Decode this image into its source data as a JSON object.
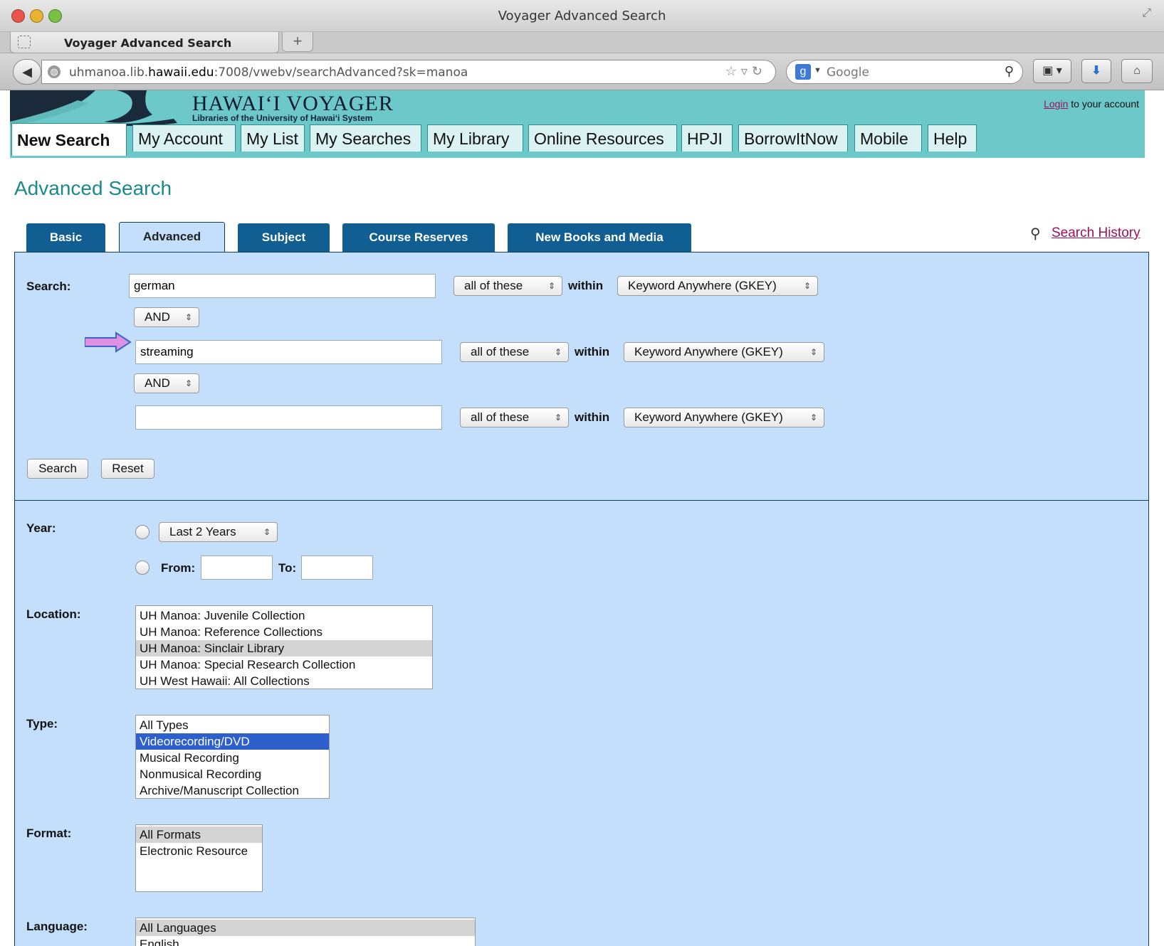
{
  "window": {
    "title": "Voyager Advanced Search"
  },
  "browser": {
    "tab_title": "Voyager Advanced Search",
    "new_tab": "+",
    "url_host_pre": "uhmanoa.lib.",
    "url_host_bold": "hawaii.edu",
    "url_rest": ":7008/vwebv/searchAdvanced?sk=manoa",
    "search_engine": "Google"
  },
  "header": {
    "site_title": "HAWAI‘I VOYAGER",
    "site_subtitle": "Libraries of the University of Hawai‘i System",
    "login_link": "Login",
    "login_suffix": " to your account"
  },
  "main_tabs": [
    {
      "label": "New Search"
    },
    {
      "label": "My Account"
    },
    {
      "label": "My List"
    },
    {
      "label": "My Searches"
    },
    {
      "label": "My Library"
    },
    {
      "label": "Online Resources"
    },
    {
      "label": "HPJI"
    },
    {
      "label": "BorrowItNow"
    },
    {
      "label": "Mobile"
    },
    {
      "label": "Help"
    }
  ],
  "page_title": "Advanced Search",
  "search_tabs": [
    {
      "label": "Basic"
    },
    {
      "label": "Advanced"
    },
    {
      "label": "Subject"
    },
    {
      "label": "Course Reserves"
    },
    {
      "label": "New Books and Media"
    }
  ],
  "search_history": "Search History",
  "search": {
    "label": "Search:",
    "rows": [
      {
        "value": "german",
        "match": "all of these",
        "within": "within",
        "field": "Keyword Anywhere (GKEY)"
      },
      {
        "value": "streaming",
        "match": "all of these",
        "within": "within",
        "field": "Keyword Anywhere (GKEY)"
      },
      {
        "value": "",
        "match": "all of these",
        "within": "within",
        "field": "Keyword Anywhere (GKEY)"
      }
    ],
    "booleans": [
      "AND",
      "AND"
    ],
    "search_button": "Search",
    "reset_button": "Reset"
  },
  "year": {
    "label": "Year:",
    "preset": "Last 2 Years",
    "from_label": "From:",
    "to_label": "To:",
    "from_value": "",
    "to_value": ""
  },
  "location": {
    "label": "Location:",
    "options": [
      "UH Manoa: Juvenile Collection",
      "UH Manoa: Reference Collections",
      "UH Manoa: Sinclair Library",
      "UH Manoa: Special Research Collection",
      "UH West Hawaii: All Collections"
    ]
  },
  "type": {
    "label": "Type:",
    "options": [
      "All Types",
      "Videorecording/DVD",
      "Musical Recording",
      "Nonmusical Recording",
      "Archive/Manuscript Collection"
    ]
  },
  "format": {
    "label": "Format:",
    "options": [
      "All Formats",
      "Electronic Resource"
    ]
  },
  "language": {
    "label": "Language:",
    "options": [
      "All Languages",
      "English"
    ]
  },
  "colors": {
    "header_teal": "#6cc8c9",
    "panel_blue": "#c4dffb",
    "tab_navy": "#115e92",
    "link_magenta": "#a0105a",
    "selected_blue": "#2d5fcd",
    "annotation_arrow": "#e090e0"
  }
}
